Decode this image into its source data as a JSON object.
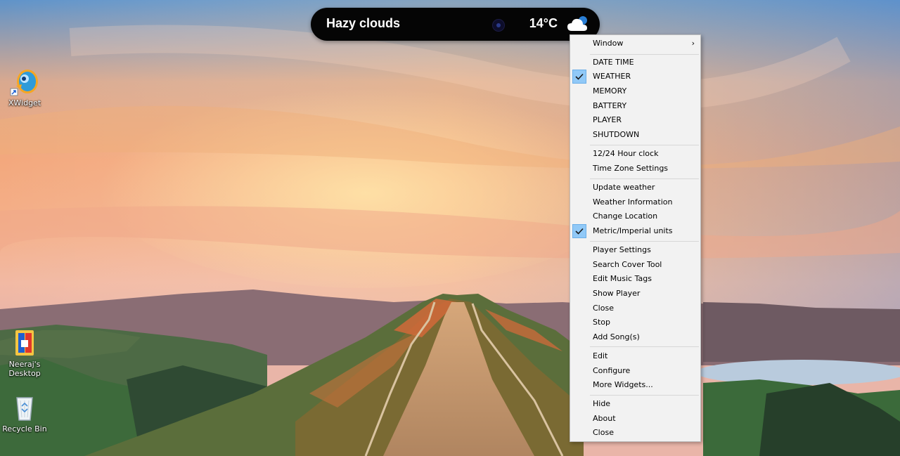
{
  "desktop": {
    "icons": [
      {
        "label": "XWidget",
        "icon": "xwidget-icon"
      },
      {
        "label": "Neeraj's Desktop",
        "icon": "folder-icon"
      },
      {
        "label": "Recycle Bin",
        "icon": "recycle-bin-icon"
      }
    ]
  },
  "widget": {
    "condition": "Hazy clouds",
    "temperature": "14°C",
    "weather_icon": "partly-cloudy-icon"
  },
  "menu": {
    "window": "Window",
    "modules": [
      "DATE TIME",
      "WEATHER",
      "MEMORY",
      "BATTERY",
      "PLAYER",
      "SHUTDOWN"
    ],
    "clock": [
      "12/24 Hour clock",
      "Time Zone Settings"
    ],
    "weather": [
      "Update weather",
      "Weather Information",
      "Change Location",
      "Metric/Imperial units"
    ],
    "player": [
      "Player Settings",
      "Search Cover Tool",
      "Edit Music Tags",
      "Show Player",
      "Close",
      "Stop",
      "Add Song(s)"
    ],
    "edit": [
      "Edit",
      "Configure",
      "More Widgets..."
    ],
    "app": [
      "Hide",
      "About",
      "Close"
    ],
    "checked_color": "#91c9f7"
  }
}
